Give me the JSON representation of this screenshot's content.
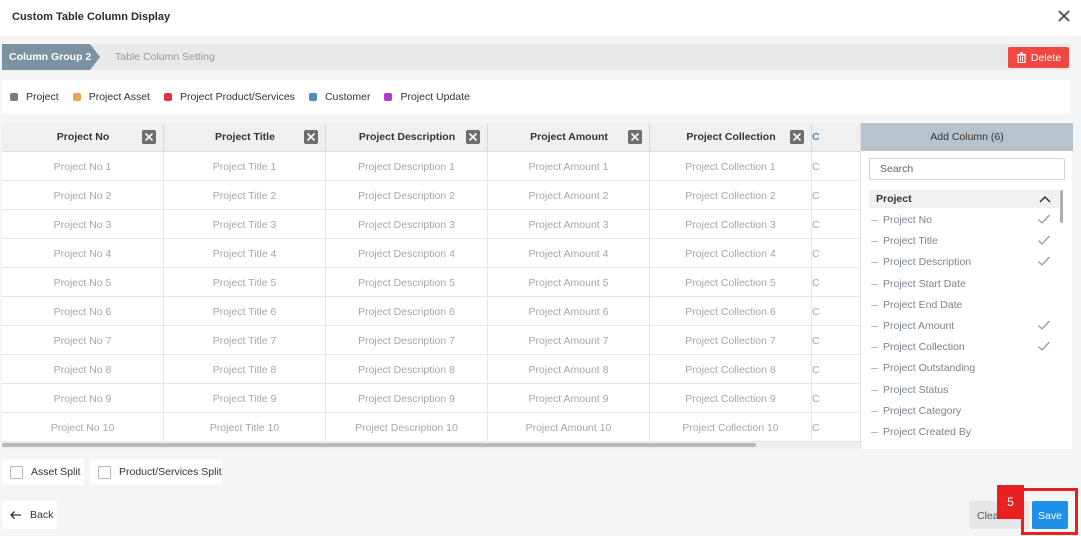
{
  "dialog": {
    "title": "Custom Table Column Display"
  },
  "tabs": {
    "active": "Column Group 2",
    "inactive": "Table Column Setting"
  },
  "delete_label": "Delete",
  "legend": [
    {
      "label": "Project",
      "color": "#7a7a7a"
    },
    {
      "label": "Project Asset",
      "color": "#f0a259"
    },
    {
      "label": "Project Product/Services",
      "color": "#e0304a"
    },
    {
      "label": "Customer",
      "color": "#4a8cc2"
    },
    {
      "label": "Project Update",
      "color": "#b23ad0"
    }
  ],
  "table": {
    "columns": [
      "Project No",
      "Project Title",
      "Project Description",
      "Project Amount",
      "Project Collection",
      "C"
    ],
    "rows": [
      [
        "Project No 1",
        "Project Title 1",
        "Project Description 1",
        "Project Amount 1",
        "Project Collection 1",
        "C"
      ],
      [
        "Project No 2",
        "Project Title 2",
        "Project Description 2",
        "Project Amount 2",
        "Project Collection 2",
        "C"
      ],
      [
        "Project No 3",
        "Project Title 3",
        "Project Description 3",
        "Project Amount 3",
        "Project Collection 3",
        "C"
      ],
      [
        "Project No 4",
        "Project Title 4",
        "Project Description 4",
        "Project Amount 4",
        "Project Collection 4",
        "C"
      ],
      [
        "Project No 5",
        "Project Title 5",
        "Project Description 5",
        "Project Amount 5",
        "Project Collection 5",
        "C"
      ],
      [
        "Project No 6",
        "Project Title 6",
        "Project Description 6",
        "Project Amount 6",
        "Project Collection 6",
        "C"
      ],
      [
        "Project No 7",
        "Project Title 7",
        "Project Description 7",
        "Project Amount 7",
        "Project Collection 7",
        "C"
      ],
      [
        "Project No 8",
        "Project Title 8",
        "Project Description 8",
        "Project Amount 8",
        "Project Collection 8",
        "C"
      ],
      [
        "Project No 9",
        "Project Title 9",
        "Project Description 9",
        "Project Amount 9",
        "Project Collection 9",
        "C"
      ],
      [
        "Project No 10",
        "Project Title 10",
        "Project Description 10",
        "Project Amount 10",
        "Project Collection 10",
        "C"
      ]
    ]
  },
  "add_column": {
    "header": "Add Column (6)",
    "search_placeholder": "Search",
    "group": "Project",
    "options": [
      {
        "label": "Project No",
        "checked": true
      },
      {
        "label": "Project Title",
        "checked": true
      },
      {
        "label": "Project Description",
        "checked": true
      },
      {
        "label": "Project Start Date",
        "checked": false
      },
      {
        "label": "Project End Date",
        "checked": false
      },
      {
        "label": "Project Amount",
        "checked": true
      },
      {
        "label": "Project Collection",
        "checked": true
      },
      {
        "label": "Project Outstanding",
        "checked": false
      },
      {
        "label": "Project Status",
        "checked": false
      },
      {
        "label": "Project Category",
        "checked": false
      },
      {
        "label": "Project Created By",
        "checked": false
      }
    ]
  },
  "splits": {
    "asset": "Asset Split",
    "product": "Product/Services Split"
  },
  "footer": {
    "back": "Back",
    "clear": "Clear",
    "save": "Save",
    "step_badge": "5"
  }
}
